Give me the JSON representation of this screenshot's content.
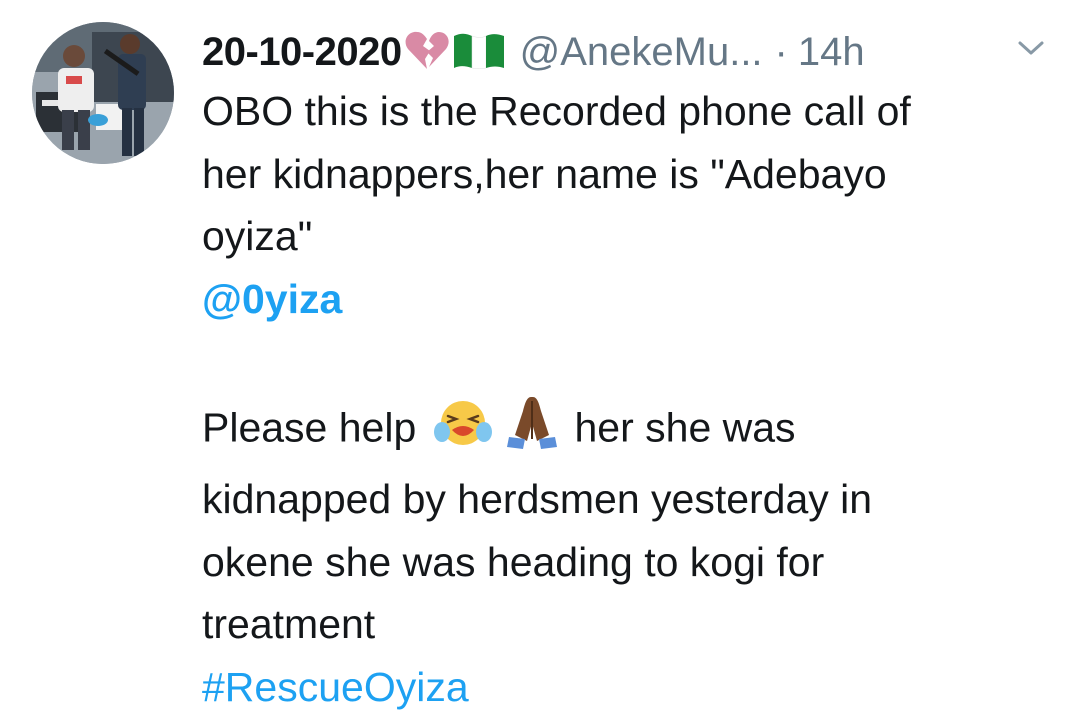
{
  "tweet": {
    "author_name": "20-10-2020",
    "author_handle": "@AnekeMu...",
    "separator": "·",
    "timestamp": "14h",
    "name_emojis": [
      "broken-heart-emoji",
      "nigeria-flag-emoji"
    ],
    "body_lines": [
      "OBO this is the Recorded phone call of",
      "her kidnappers,her name is \"Adebayo",
      "oyiza\""
    ],
    "mention": "@0yiza",
    "plea_start": "Please help",
    "plea_end": "her she was",
    "plea_emojis": [
      "crying-face-emoji",
      "folded-hands-emoji"
    ],
    "story_lines": [
      "kidnapped by herdsmen yesterday in",
      "okene she was heading to kogi for",
      "treatment"
    ],
    "hashtag": "#RescueOyiza"
  },
  "colors": {
    "text": "#14171a",
    "secondary": "#657786",
    "link": "#1da1f2"
  },
  "icons": {
    "menu": "chevron-down-icon",
    "avatar": "profile-photo"
  }
}
